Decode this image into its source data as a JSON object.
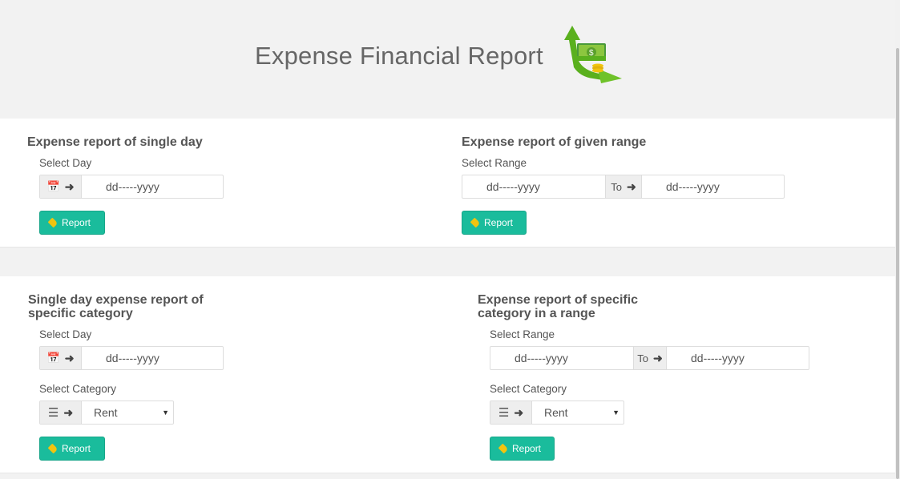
{
  "header": {
    "title": "Expense Financial Report",
    "logo_icon": "money-growth-icon"
  },
  "single_day": {
    "title": "Expense report of single day",
    "label": "Select Day",
    "date_placeholder": "dd-----yyyy",
    "button": "Report"
  },
  "given_range": {
    "title": "Expense report of given range",
    "label": "Select Range",
    "from_placeholder": "dd-----yyyy",
    "to_label": "To",
    "to_placeholder": "dd-----yyyy",
    "button": "Report"
  },
  "single_day_category": {
    "title_line1": "Single day expense report of",
    "title_line2": "specific category",
    "day_label": "Select Day",
    "date_placeholder": "dd-----yyyy",
    "category_label": "Select Category",
    "category_value": "Rent",
    "button": "Report"
  },
  "category_range": {
    "title_line1": "Expense report of specific",
    "title_line2": "category in a range",
    "range_label": "Select Range",
    "from_placeholder": "dd-----yyyy",
    "to_label": "To",
    "to_placeholder": "dd-----yyyy",
    "category_label": "Select Category",
    "category_value": "Rent",
    "button": "Report"
  },
  "colors": {
    "accent": "#1abc9c",
    "tag_icon": "#f1c40f",
    "background": "#f2f2f2"
  }
}
